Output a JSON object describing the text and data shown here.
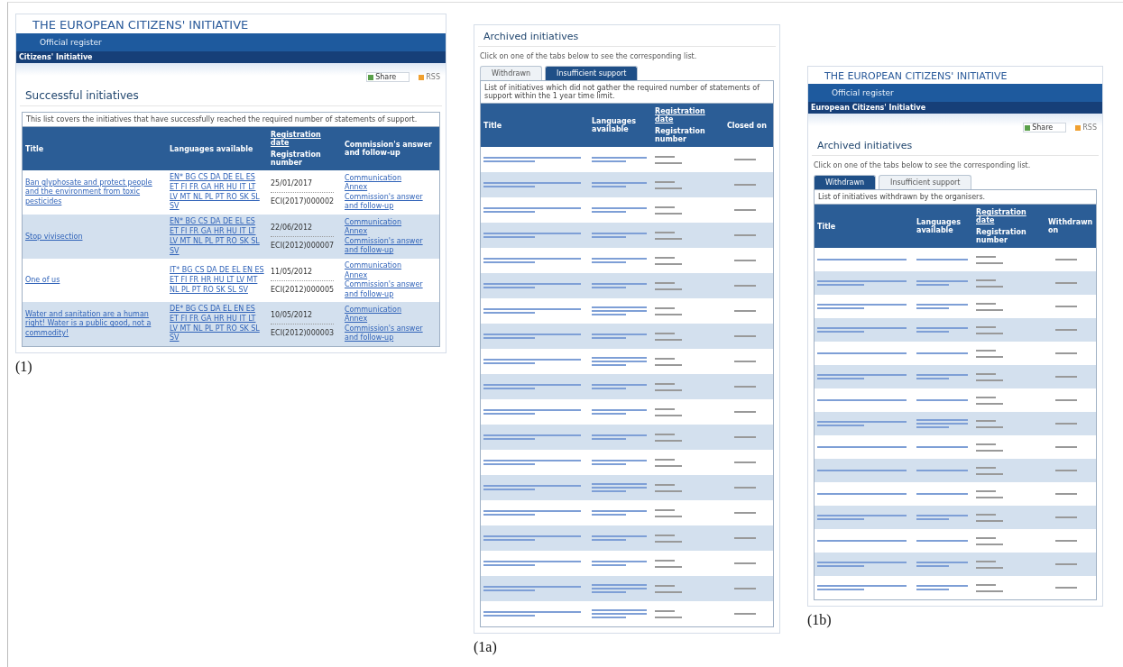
{
  "panel_1": {
    "header": {
      "title": "THE EUROPEAN CITIZENS' INITIATIVE",
      "subtitle": "Official register",
      "breadcrumb": "Citizens' Initiative"
    },
    "share": "Share",
    "rss": "RSS",
    "heading": "Successful initiatives",
    "description": "This list covers the initiatives that have successfully reached the required number of statements of support.",
    "columns": [
      "Title",
      "Languages available",
      "Registration date",
      "Registration number",
      "Commission's answer and follow-up"
    ],
    "rows": [
      {
        "title": "Ban glyphosate and protect people and the environment from toxic pesticides",
        "languages": "EN* BG CS DA DE EL ES ET FI FR GA HR HU IT LT LV MT NL PL PT RO SK SL SV",
        "date": "25/01/2017",
        "number": "ECI(2017)000002",
        "links": [
          "Communication",
          "Annex",
          "Commission's answer and follow-up"
        ]
      },
      {
        "title": "Stop vivisection",
        "languages": "EN* BG CS DA DE EL ES ET FI FR GA HR HU IT LT LV MT NL PL PT RO SK SL SV",
        "date": "22/06/2012",
        "number": "ECI(2012)000007",
        "links": [
          "Communication",
          "Annex",
          "Commission's answer and follow-up"
        ]
      },
      {
        "title": "One of us",
        "languages": "IT* BG CS DA DE EL EN ES ET FI FR HR HU LT LV MT NL PL PT RO SK SL SV",
        "date": "11/05/2012",
        "number": "ECI(2012)000005",
        "links": [
          "Communication",
          "Annex",
          "Commission's answer and follow-up"
        ]
      },
      {
        "title": "Water and sanitation are a human right! Water is a public good, not a commodity!",
        "languages": "DE* BG CS DA EL EN ES ET FI FR GA HR HU IT LT LV MT NL PL PT RO SK SL SV",
        "date": "10/05/2012",
        "number": "ECI(2012)000003",
        "links": [
          "Communication",
          "Annex",
          "Commission's answer and follow-up"
        ]
      }
    ],
    "caption": "(1)"
  },
  "panel_1a": {
    "heading": "Archived initiatives",
    "intro": "Click on one of the tabs below to see the corresponding list.",
    "tabs": [
      {
        "label": "Withdrawn",
        "selected": false
      },
      {
        "label": "Insufficient support",
        "selected": true
      }
    ],
    "description": "List of initiatives which did not gather the required number of statements of support within the 1 year time limit.",
    "columns": [
      "Title",
      "Languages available",
      "Registration date",
      "Registration number",
      "Closed on"
    ],
    "caption": "(1a)"
  },
  "panel_1b": {
    "header": {
      "title": "THE EUROPEAN CITIZENS' INITIATIVE",
      "subtitle": "Official register",
      "breadcrumb": "European Citizens' Initiative"
    },
    "share": "Share",
    "rss": "RSS",
    "heading": "Archived initiatives",
    "intro": "Click on one of the tabs below to see the corresponding list.",
    "tabs": [
      {
        "label": "Withdrawn",
        "selected": true
      },
      {
        "label": "Insufficient support",
        "selected": false
      }
    ],
    "description": "List of initiatives withdrawn by the organisers.",
    "columns": [
      "Title",
      "Languages available",
      "Registration date",
      "Registration number",
      "Withdrawn on"
    ],
    "caption": "(1b)"
  }
}
